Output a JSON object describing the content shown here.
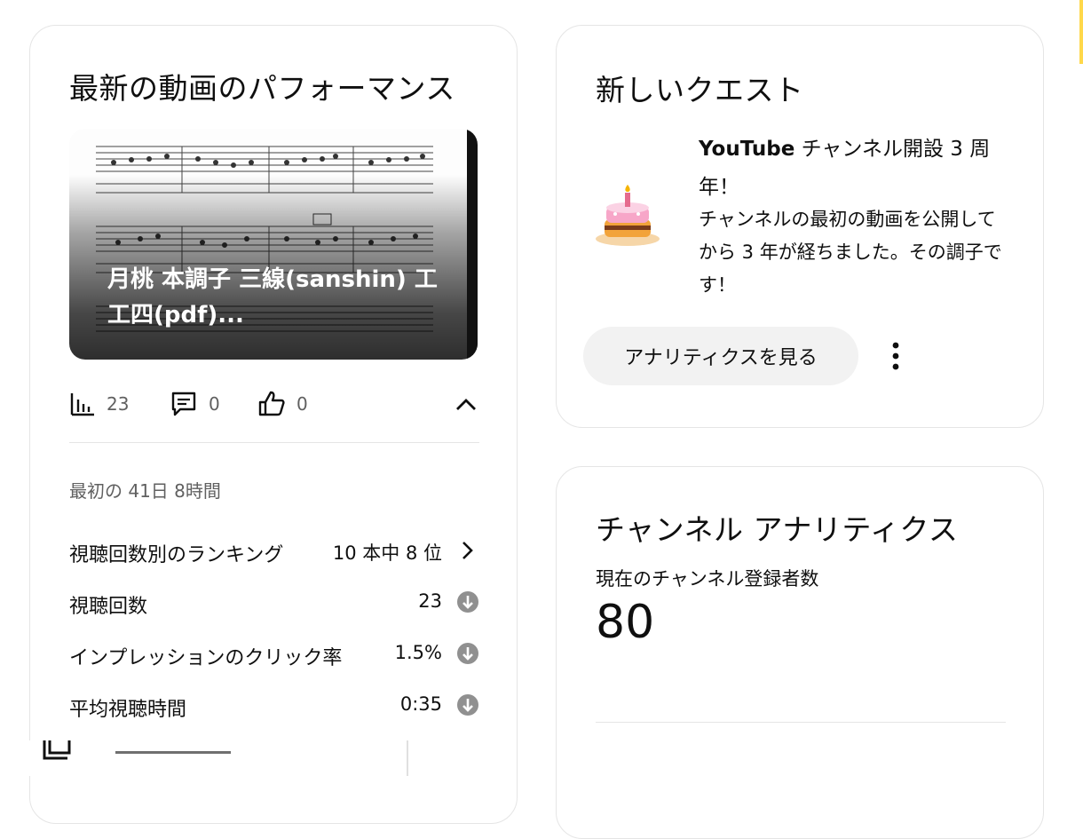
{
  "performance_card": {
    "title": "最新の動画のパフォーマンス",
    "video_title": "月桃 本調子 三線(sanshin) 工工四(pdf)...",
    "stats": {
      "views": "23",
      "comments": "0",
      "likes": "0"
    },
    "period": "最初の 41日 8時間",
    "metrics": [
      {
        "label": "視聴回数別のランキング",
        "value": "10 本中 8 位",
        "icon": "chevron-right-icon"
      },
      {
        "label": "視聴回数",
        "value": "23",
        "icon": "arrow-down-circle-icon"
      },
      {
        "label": "インプレッションのクリック率",
        "value": "1.5%",
        "icon": "arrow-down-circle-icon"
      },
      {
        "label": "平均視聴時間",
        "value": "0:35",
        "icon": "arrow-down-circle-icon"
      }
    ]
  },
  "quest_card": {
    "title": "新しいクエスト",
    "quest_title_bold": "YouTube",
    "quest_title_rest": " チャンネル開設 3 周年！",
    "quest_title_num": "",
    "description": "チャンネルの最初の動画を公開してから 3 年が経ちました。その調子です！",
    "button_label": "アナリティクスを見る",
    "icon": "birthday-cake-icon"
  },
  "analytics_card": {
    "title": "チャンネル アナリティクス",
    "subscribers_label": "現在のチャンネル登録者数",
    "subscribers_value": "80"
  },
  "colors": {
    "card_border": "#e5e5e5",
    "pill_bg": "#f2f2f2",
    "secondary_text": "#606060",
    "down_icon": "#909090"
  }
}
